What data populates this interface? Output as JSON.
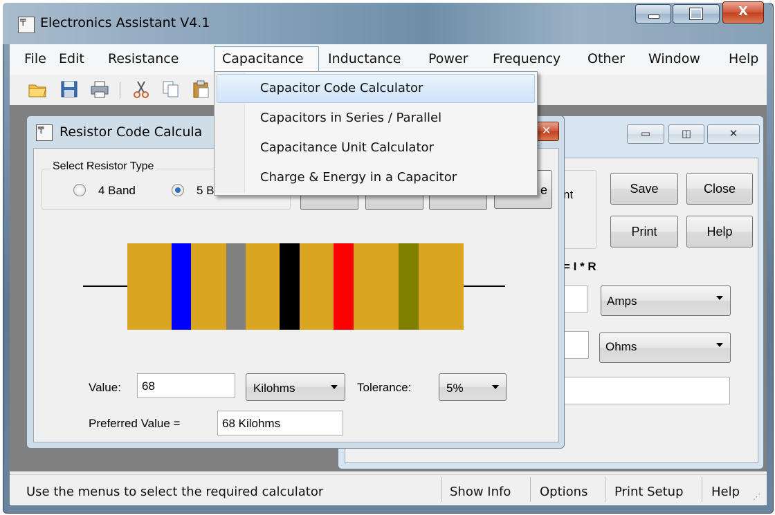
{
  "app": {
    "title": "Electronics Assistant V4.1",
    "close_glyph": "X"
  },
  "menu": [
    "File",
    "Edit",
    "Resistance",
    "Capacitance",
    "Inductance",
    "Power",
    "Frequency",
    "Other",
    "Window",
    "Help"
  ],
  "capacitance_menu": [
    "Capacitor Code Calculator",
    "Capacitors in Series / Parallel",
    "Capacitance Unit Calculator",
    "Charge & Energy in a Capacitor"
  ],
  "back_window": {
    "partial_text": "nt",
    "save": "Save",
    "close": "Close",
    "print": "Print",
    "help": "Help",
    "formula": "= I * R",
    "amps": "Amps",
    "ohms": "Ohms"
  },
  "front_window": {
    "title": "Resistor Code Calcula",
    "group_label": "Select Resistor Type",
    "radio_4": "4 Band",
    "radio_5": "5 B",
    "value_label": "Value:",
    "value": "68",
    "unit": "Kilohms",
    "tolerance_label": "Tolerance:",
    "tolerance": "5%",
    "preferred_label": "Preferred Value =",
    "preferred_value": "68 Kilohms",
    "partial_button_text": "e"
  },
  "resistor_bands": [
    "#0000ff",
    "#808080",
    "#000000",
    "#ff0000",
    "#808000"
  ],
  "status": {
    "message": "Use the menus to select the required calculator",
    "show_info": "Show Info",
    "options": "Options",
    "print_setup": "Print Setup",
    "help": "Help"
  }
}
